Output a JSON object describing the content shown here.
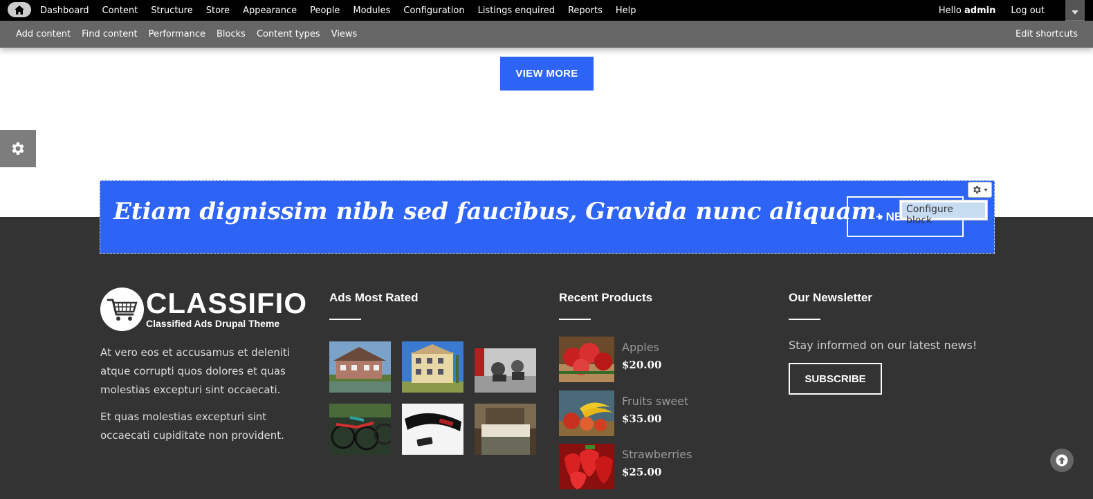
{
  "admin_toolbar": {
    "home_icon": "home-icon",
    "menu": [
      "Dashboard",
      "Content",
      "Structure",
      "Store",
      "Appearance",
      "People",
      "Modules",
      "Configuration",
      "Listings enquired",
      "Reports",
      "Help"
    ],
    "hello_prefix": "Hello",
    "username": "admin",
    "logout": "Log out",
    "toggle_icon": "chevron-down-icon"
  },
  "shortcuts": {
    "items": [
      "Add content",
      "Find content",
      "Performance",
      "Blocks",
      "Content types",
      "Views"
    ],
    "edit": "Edit shortcuts"
  },
  "main": {
    "view_more": "VIEW MORE",
    "settings_icon": "gear-icon"
  },
  "promo": {
    "text": "Etiam dignissim nibh sed faucibus, Gravida nunc aliquam.",
    "button": "+ NE",
    "gear_icon": "gear-icon",
    "configure_block": "Configure block",
    "color": "#2d64f5"
  },
  "footer": {
    "brand": {
      "name": "CLASSIFIO",
      "tagline": "Classified Ads Drupal Theme",
      "logo_icon": "shopping-cart-icon"
    },
    "about": [
      "At vero eos et accusamus et deleniti atque corrupti quos dolores et quas molestias excepturi sint occaecati.",
      "Et quas molestias excepturi sint occaecati cupiditate non provident."
    ],
    "ads_most_rated": {
      "title": "Ads Most Rated",
      "thumbnails": [
        "house-photo",
        "building-photo",
        "gym-photo",
        "bicycles-photo",
        "gadget-photo",
        "bedroom-photo"
      ]
    },
    "recent_products": {
      "title": "Recent Products",
      "items": [
        {
          "name": "Apples",
          "price": "$20.00"
        },
        {
          "name": "Fruits sweet",
          "price": "$35.00"
        },
        {
          "name": "Strawberries",
          "price": "$25.00"
        }
      ]
    },
    "newsletter": {
      "title": "Our Newsletter",
      "text": "Stay informed on our latest news!",
      "button": "SUBSCRIBE"
    },
    "scroll_top_icon": "arrow-up-icon"
  },
  "colors": {
    "accent": "#2d64f5",
    "footer_bg": "#333333",
    "admin_bar": "#000000",
    "shortcut_bar": "#666666"
  }
}
